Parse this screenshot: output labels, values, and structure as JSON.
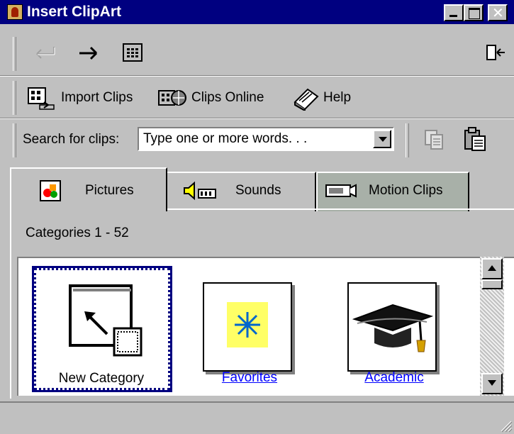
{
  "window": {
    "title": "Insert ClipArt",
    "title_bar_color": "#000080"
  },
  "caption_buttons": [
    {
      "icon": "minimize-icon"
    },
    {
      "icon": "maximize-icon"
    },
    {
      "icon": "close-icon"
    }
  ],
  "nav_toolbar": {
    "back_icon": "back-arrow-icon",
    "forward_icon": "forward-arrow-icon",
    "all_categories_icon": "grid-icon",
    "change_size_icon": "restore-window-icon"
  },
  "toolbar": {
    "import_clips": "Import Clips",
    "clips_online": "Clips Online",
    "help": "Help"
  },
  "search": {
    "label": "Search for clips:",
    "value": "Type one or more words. . ."
  },
  "tabs": [
    {
      "label": "Pictures",
      "icon": "pictures-icon",
      "active": true
    },
    {
      "label": "Sounds",
      "icon": "speaker-icon",
      "active": false
    },
    {
      "label": "Motion Clips",
      "icon": "camera-icon",
      "active": false
    }
  ],
  "categories_heading": "Categories 1 - 52",
  "categories": [
    {
      "label": "New Category",
      "icon": "new-category-icon",
      "selected": true,
      "link": false
    },
    {
      "label": "Favorites",
      "icon": "star-icon",
      "selected": false,
      "link": true
    },
    {
      "label": "Academic",
      "icon": "graduation-cap-icon",
      "selected": false,
      "link": true
    }
  ],
  "colors": {
    "link": "#0000ff",
    "selection_border": "#000080",
    "favorites_bg": "#ffff66",
    "favorites_star": "#0066cc"
  }
}
